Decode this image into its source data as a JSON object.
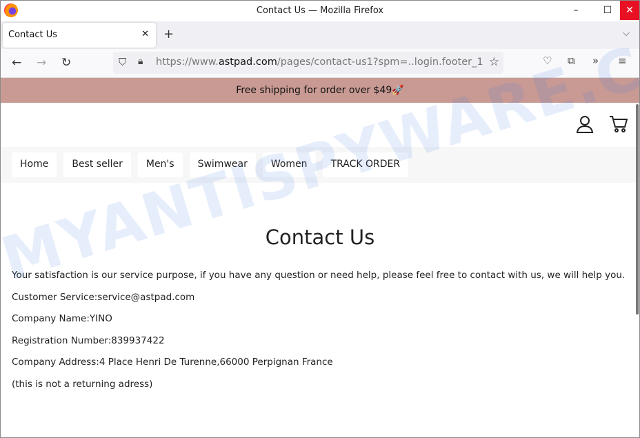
{
  "window": {
    "title": "Contact Us — Mozilla Firefox"
  },
  "tab": {
    "label": "Contact Us"
  },
  "url": {
    "prefix": "https://www.",
    "domain": "astpad.com",
    "suffix": "/pages/contact-us1?spm=..login.footer_1"
  },
  "banner": "Free shipping for order over $49🚀",
  "menu": [
    "Home",
    "Best seller",
    "Men's",
    "Swimwear",
    "Women",
    "TRACK ORDER"
  ],
  "page": {
    "title": "Contact Us",
    "lines": [
      "Your satisfaction is our service purpose, if you have any question or need help, please feel free to contact with us, we will help you.",
      "Customer Service:service@astpad.com",
      "Company Name:YINO",
      "Registration Number:839937422",
      "Company Address:4 Place Henri De Turenne,66000 Perpignan France",
      "(this is not a returning adress)"
    ]
  },
  "watermark": "MYANTISPYWARE.COM"
}
